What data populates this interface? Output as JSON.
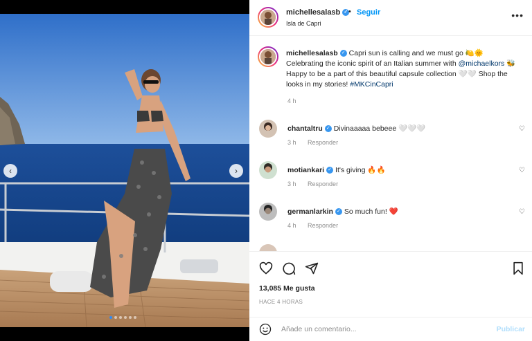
{
  "post": {
    "username": "michellesalasb",
    "follow_label": "Seguir",
    "separator": "•",
    "location": "Isla de Capri",
    "more_label": "•••"
  },
  "caption": {
    "username": "michellesalasb",
    "text_1": "Capri sun is calling and we must go 🍋🌞 Celebrating the iconic spirit of an Italian summer with ",
    "mention": "@michaelkors",
    "text_2": " 🐝 Happy to be a part of this beautiful capsule collection 🤍🤍 Shop the looks in my stories! ",
    "hashtag": "#MKCinCapri",
    "time": "4 h"
  },
  "comments": [
    {
      "username": "chantaltru",
      "text": "Divinaaaaa bebeee 🤍🤍🤍",
      "time": "3 h",
      "reply": "Responder"
    },
    {
      "username": "motiankari",
      "text": "It's giving 🔥🔥",
      "time": "3 h",
      "reply": "Responder"
    },
    {
      "username": "germanlarkin",
      "text": "So much fun! ❤️",
      "time": "4 h",
      "reply": "Responder"
    }
  ],
  "stats": {
    "likes": "13,085 Me gusta",
    "ago": "HACE 4 HORAS"
  },
  "add_comment": {
    "placeholder": "Añade un comentario...",
    "publish_label": "Publicar"
  },
  "carousel": {
    "prev": "‹",
    "next": "›",
    "active_index": 0,
    "count": 6
  },
  "colors": {
    "accent": "#0095f6",
    "verified": "#3897f0",
    "mention": "#00376b",
    "publish_disabled": "#b2dffc",
    "like_heart": "#ed4956"
  }
}
